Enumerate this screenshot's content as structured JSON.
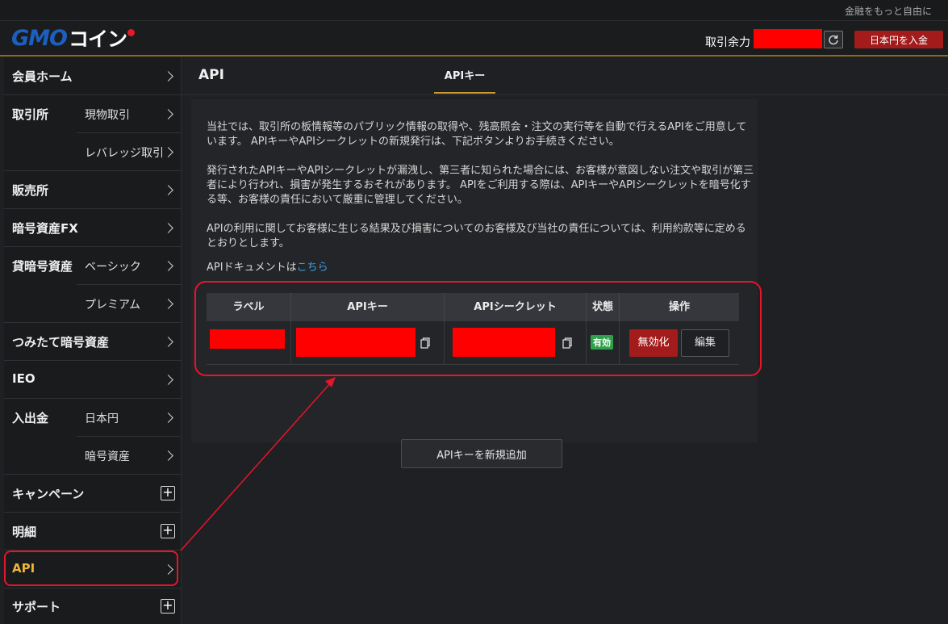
{
  "topbar": {
    "tagline": "金融をもっと自由に"
  },
  "header": {
    "logo": {
      "gmo": "GMO",
      "coin": "コイン"
    },
    "balance_label": "取引余力",
    "deposit_label": "日本円を入金"
  },
  "sidebar": {
    "items": [
      {
        "label": "会員ホーム"
      },
      {
        "label": "取引所",
        "subs": [
          "現物取引",
          "レバレッジ取引"
        ]
      },
      {
        "label": "販売所"
      },
      {
        "label": "暗号資産FX"
      },
      {
        "label": "貸暗号資産",
        "subs": [
          "ベーシック",
          "プレミアム"
        ]
      },
      {
        "label": "つみたて暗号資産"
      },
      {
        "label": "IEO"
      },
      {
        "label": "入出金",
        "subs": [
          "日本円",
          "暗号資産"
        ]
      },
      {
        "label": "キャンペーン"
      },
      {
        "label": "明細"
      },
      {
        "label": "API"
      },
      {
        "label": "サポート"
      }
    ]
  },
  "main": {
    "title": "API",
    "tab": "APIキー",
    "paragraphs": [
      "当社では、取引所の板情報等のパブリック情報の取得や、残高照会・注文の実行等を自動で行えるAPIをご用意しています。 APIキーやAPIシークレットの新規発行は、下記ボタンよりお手続きください。",
      "発行されたAPIキーやAPIシークレットが漏洩し、第三者に知られた場合には、お客様が意図しない注文や取引が第三者により行われ、損害が発生するおそれがあります。 APIをご利用する際は、APIキーやAPIシークレットを暗号化する等、お客様の責任において厳重に管理してください。",
      "APIの利用に関してお客様に生じる結果及び損害についてのお客様及び当社の責任については、利用約款等に定めるとおりとします。"
    ],
    "doc_prefix": "APIドキュメントは",
    "doc_link": "こちら",
    "table": {
      "headers": [
        "ラベル",
        "APIキー",
        "APIシークレット",
        "状態",
        "操作"
      ],
      "row": {
        "status": "有効",
        "disable": "無効化",
        "edit": "編集"
      }
    },
    "add_button": "APIキーを新規追加"
  },
  "colors": {
    "accent_gold": "#c99a2e",
    "danger_red": "#a31b1b",
    "status_green": "#2ea24a",
    "annotation_red": "#e8142a"
  }
}
